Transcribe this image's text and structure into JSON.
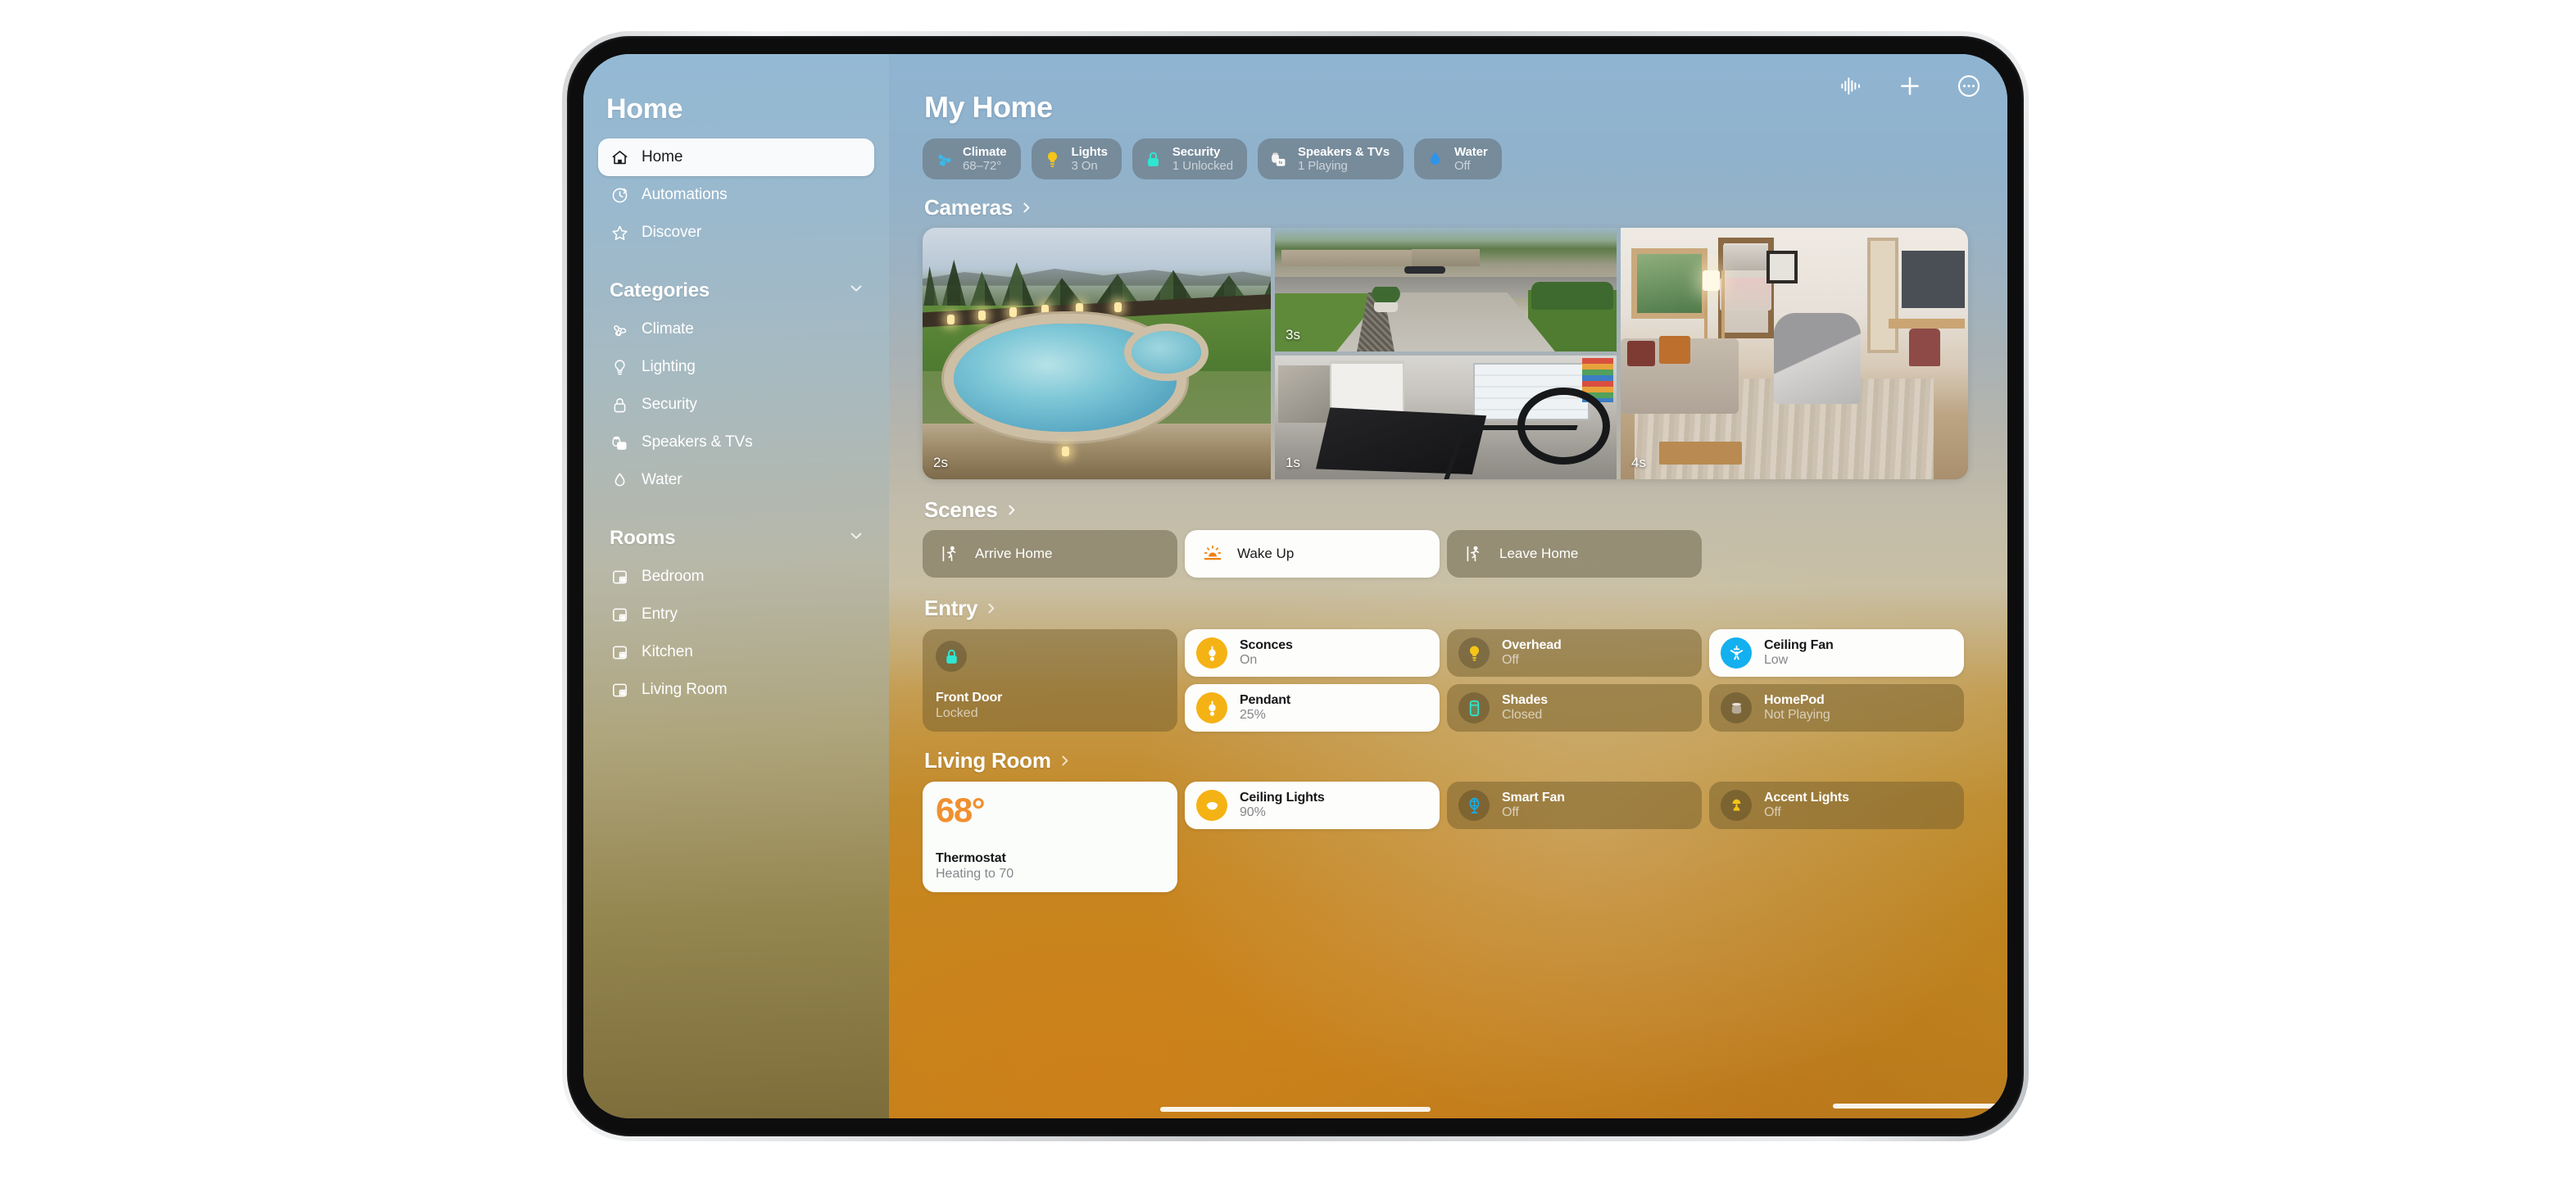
{
  "sidebar": {
    "title": "Home",
    "nav": [
      {
        "label": "Home",
        "icon": "house-icon",
        "selected": true
      },
      {
        "label": "Automations",
        "icon": "clock-arrow-icon",
        "selected": false
      },
      {
        "label": "Discover",
        "icon": "star-icon",
        "selected": false
      }
    ],
    "categories_header": "Categories",
    "categories": [
      {
        "label": "Climate",
        "icon": "fan-icon"
      },
      {
        "label": "Lighting",
        "icon": "bulb-icon"
      },
      {
        "label": "Security",
        "icon": "lock-icon"
      },
      {
        "label": "Speakers & TVs",
        "icon": "speaker-tv-icon"
      },
      {
        "label": "Water",
        "icon": "water-drop-icon"
      }
    ],
    "rooms_header": "Rooms",
    "rooms": [
      {
        "label": "Bedroom",
        "icon": "room-icon"
      },
      {
        "label": "Entry",
        "icon": "room-icon"
      },
      {
        "label": "Kitchen",
        "icon": "room-icon"
      },
      {
        "label": "Living Room",
        "icon": "room-icon"
      }
    ]
  },
  "toolbar": {
    "siri_waveform": "waveform-icon",
    "add": "plus-icon",
    "more": "ellipsis-circle-icon"
  },
  "header": {
    "title": "My Home"
  },
  "status_pills": [
    {
      "title": "Climate",
      "subtitle": "68–72°",
      "icon": "fan-icon",
      "color": "#3cb8ea"
    },
    {
      "title": "Lights",
      "subtitle": "3 On",
      "icon": "bulb-icon",
      "color": "#f5c518"
    },
    {
      "title": "Security",
      "subtitle": "1 Unlocked",
      "icon": "lock-icon",
      "color": "#2fe6d0"
    },
    {
      "title": "Speakers & TVs",
      "subtitle": "1 Playing",
      "icon": "speaker-tv-icon",
      "color": "#f2f2f2"
    },
    {
      "title": "Water",
      "subtitle": "Off",
      "icon": "water-drop-icon",
      "color": "#2f93ea"
    }
  ],
  "sections": {
    "cameras": {
      "header": "Cameras"
    },
    "scenes": {
      "header": "Scenes"
    },
    "entry": {
      "header": "Entry"
    },
    "living_room": {
      "header": "Living Room"
    }
  },
  "cameras": [
    {
      "name": "backyard-pool-camera",
      "timestamp": "2s"
    },
    {
      "name": "front-driveway-camera",
      "timestamp": "3s"
    },
    {
      "name": "garage-camera",
      "timestamp": "1s"
    },
    {
      "name": "living-room-camera",
      "timestamp": "4s"
    }
  ],
  "scenes": [
    {
      "label": "Arrive Home",
      "icon": "figure-walk-arrive-icon",
      "active": false
    },
    {
      "label": "Wake Up",
      "icon": "sunrise-icon",
      "active": true
    },
    {
      "label": "Leave Home",
      "icon": "figure-walk-leave-icon",
      "active": false
    }
  ],
  "entry_accessories": {
    "front_door": {
      "title": "Front Door",
      "status": "Locked",
      "icon": "lock-icon",
      "state": "dim",
      "accent": "#2fe6d0"
    },
    "items": [
      {
        "title": "Sconces",
        "status": "On",
        "icon": "sconce-icon",
        "state": "on",
        "accent": "#f5b214"
      },
      {
        "title": "Pendant",
        "status": "25%",
        "icon": "sconce-icon",
        "state": "on",
        "accent": "#f5b214"
      },
      {
        "title": "Overhead",
        "status": "Off",
        "icon": "bulb-icon",
        "state": "off",
        "accent": "#f5c518"
      },
      {
        "title": "Shades",
        "status": "Closed",
        "icon": "shade-icon",
        "state": "off",
        "accent": "#2fe6d0"
      },
      {
        "title": "Ceiling Fan",
        "status": "Low",
        "icon": "ceiling-fan-icon",
        "state": "on",
        "accent": "#12b0ef"
      },
      {
        "title": "HomePod",
        "status": "Not Playing",
        "icon": "homepod-icon",
        "state": "off",
        "accent": "#b6aa96"
      }
    ]
  },
  "living_room_accessories": {
    "thermostat": {
      "temperature": "68°",
      "title": "Thermostat",
      "status": "Heating to 70",
      "state": "lit",
      "accent": "#f09030"
    },
    "items": [
      {
        "title": "Ceiling Lights",
        "status": "90%",
        "icon": "ceiling-light-icon",
        "state": "on",
        "accent": "#f5b214"
      },
      {
        "title": "Smart Fan",
        "status": "Off",
        "icon": "pedestal-fan-icon",
        "state": "off",
        "accent": "#12b0ef"
      },
      {
        "title": "Accent Lights",
        "status": "Off",
        "icon": "lamp-icon",
        "state": "off",
        "accent": "#f5c518"
      }
    ]
  }
}
